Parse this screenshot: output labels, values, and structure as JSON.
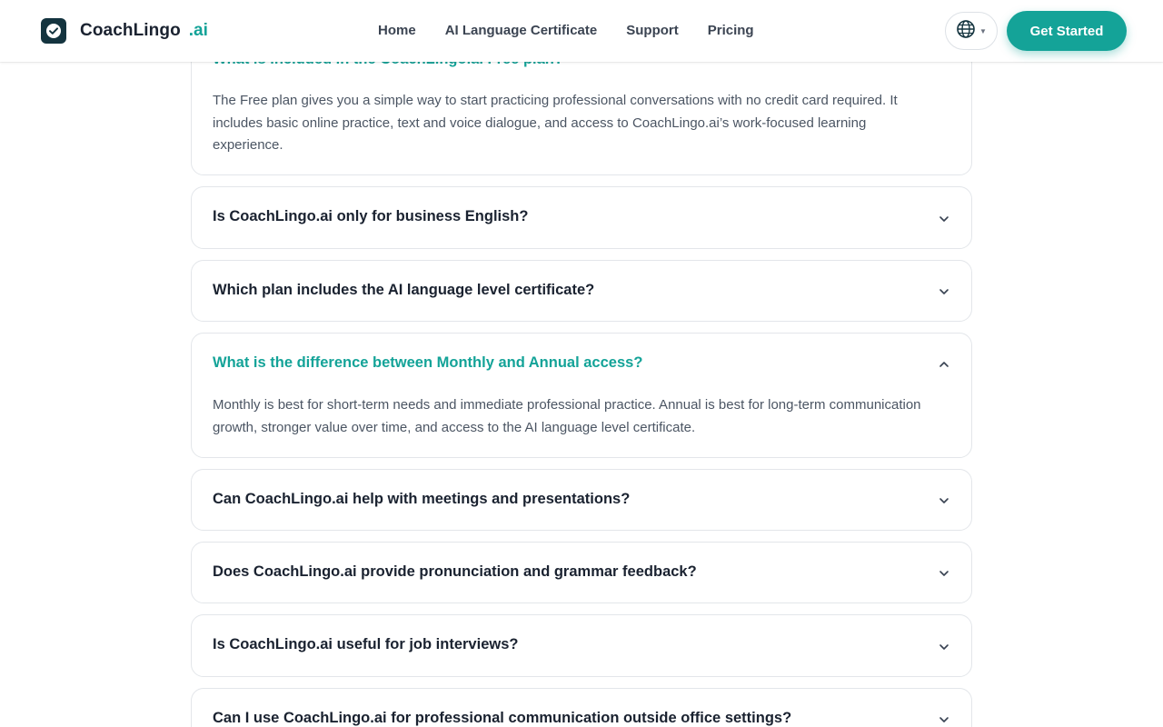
{
  "brand": {
    "name": "CoachLingo",
    "suffix": ".ai"
  },
  "nav": {
    "items": [
      "Home",
      "AI Language Certificate",
      "Support",
      "Pricing"
    ]
  },
  "header": {
    "cta_label": "Get Started",
    "language_icon": "globe-icon"
  },
  "colors": {
    "accent": "#14a398",
    "text": "#1a2230",
    "border": "#e3e6ea"
  },
  "faq": {
    "items": [
      {
        "question": "What is included in the CoachLingo.ai Free plan?",
        "answer": "The Free plan gives you a simple way to start practicing professional conversations with no credit card required. It includes basic online practice, text and voice dialogue, and access to CoachLingo.ai’s work-focused learning experience.",
        "open": true
      },
      {
        "question": "Is CoachLingo.ai only for business English?",
        "open": false
      },
      {
        "question": "Which plan includes the AI language level certificate?",
        "open": false
      },
      {
        "question": "What is the difference between Monthly and Annual access?",
        "answer": "Monthly is best for short-term needs and immediate professional practice. Annual is best for long-term communication growth, stronger value over time, and access to the AI language level certificate.",
        "open": true,
        "active": true
      },
      {
        "question": "Can CoachLingo.ai help with meetings and presentations?",
        "open": false
      },
      {
        "question": "Does CoachLingo.ai provide pronunciation and grammar feedback?",
        "open": false
      },
      {
        "question": "Is CoachLingo.ai useful for job interviews?",
        "open": false
      },
      {
        "question": "Can I use CoachLingo.ai for professional communication outside office settings?",
        "open": false
      }
    ]
  }
}
